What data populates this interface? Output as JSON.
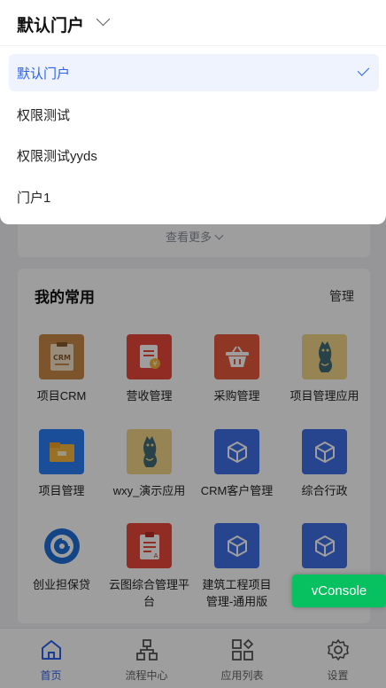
{
  "header": {
    "portal_title": "默认门户"
  },
  "portal_menu": {
    "options": [
      {
        "label": "默认门户",
        "selected": true
      },
      {
        "label": "权限测试",
        "selected": false
      },
      {
        "label": "权限测试yyds",
        "selected": false
      },
      {
        "label": "门户1",
        "selected": false
      }
    ]
  },
  "more": {
    "label": "查看更多"
  },
  "favorites": {
    "title": "我的常用",
    "manage_label": "管理",
    "apps": [
      {
        "label": "项目CRM",
        "icon": "crm-icon"
      },
      {
        "label": "营收管理",
        "icon": "revenue-icon"
      },
      {
        "label": "采购管理",
        "icon": "basket-icon"
      },
      {
        "label": "项目管理应用",
        "icon": "cat-icon"
      },
      {
        "label": "项目管理",
        "icon": "folder-icon"
      },
      {
        "label": "wxy_演示应用",
        "icon": "cat-icon"
      },
      {
        "label": "CRM客户管理",
        "icon": "cube-icon"
      },
      {
        "label": "综合行政",
        "icon": "cube-icon"
      },
      {
        "label": "创业担保贷",
        "icon": "logo-icon"
      },
      {
        "label": "云图综合管理平台",
        "icon": "clipboard-icon"
      },
      {
        "label": "建筑工程项目管理-通用版",
        "icon": "cube-icon"
      },
      {
        "label": "",
        "icon": "cube-icon"
      }
    ]
  },
  "tabbar": {
    "items": [
      {
        "label": "首页",
        "icon": "home-icon",
        "active": true
      },
      {
        "label": "流程中心",
        "icon": "flow-icon",
        "active": false
      },
      {
        "label": "应用列表",
        "icon": "apps-icon",
        "active": false
      },
      {
        "label": "设置",
        "icon": "settings-icon",
        "active": false
      }
    ]
  },
  "vconsole": {
    "label": "vConsole"
  },
  "colors": {
    "accent": "#2b62f0",
    "vconsole": "#07c160",
    "selected_bg": "#eef3fd"
  }
}
